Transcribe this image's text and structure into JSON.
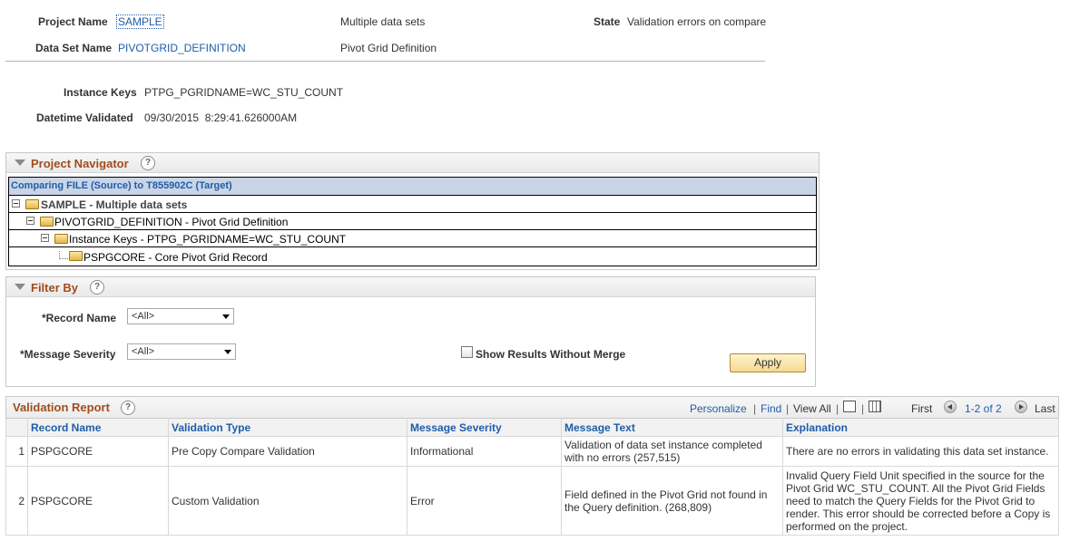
{
  "header": {
    "project_name_label": "Project Name",
    "project_name": "SAMPLE",
    "project_desc": "Multiple data sets",
    "state_label": "State",
    "state_value": "Validation errors on compare",
    "data_set_label": "Data Set Name",
    "data_set_name": "PIVOTGRID_DEFINITION",
    "data_set_desc": "Pivot Grid Definition"
  },
  "instance": {
    "keys_label": "Instance Keys",
    "keys_value": "PTPG_PGRIDNAME=WC_STU_COUNT",
    "datetime_label": "Datetime Validated",
    "datetime_value": "09/30/2015  8:29:41.626000AM"
  },
  "navigator": {
    "title": "Project Navigator",
    "help": "?",
    "caption": "Comparing FILE (Source) to T855902C (Target)",
    "nodes": [
      "SAMPLE - Multiple data sets",
      "PIVOTGRID_DEFINITION - Pivot Grid Definition",
      "Instance Keys - PTPG_PGRIDNAME=WC_STU_COUNT",
      "PSPGCORE - Core Pivot Grid Record"
    ]
  },
  "filter": {
    "title": "Filter By",
    "help": "?",
    "record_name_label": "*Record Name",
    "record_name_value": "<All>",
    "severity_label": "*Message Severity",
    "severity_value": "<All>",
    "show_results_label": "Show Results Without Merge",
    "apply_label": "Apply"
  },
  "report": {
    "title": "Validation Report",
    "help": "?",
    "personalize": "Personalize",
    "find": "Find",
    "view_all": "View All",
    "first": "First",
    "range": "1-2 of 2",
    "last": "Last",
    "columns": [
      "Record Name",
      "Validation Type",
      "Message Severity",
      "Message Text",
      "Explanation"
    ],
    "rows": [
      {
        "num": "1",
        "record": "PSPGCORE",
        "type": "Pre Copy Compare Validation",
        "severity": "Informational",
        "message": "Validation of data set instance completed with no errors (257,515)",
        "explanation": "There are no errors in validating this data set instance."
      },
      {
        "num": "2",
        "record": "PSPGCORE",
        "type": "Custom Validation",
        "severity": "Error",
        "message": "Field defined in the Pivot Grid not found in the Query definition. (268,809)",
        "explanation": "Invalid Query Field Unit specified in the source for the Pivot Grid WC_STU_COUNT. All the Pivot Grid Fields need to match the Query Fields for the Pivot Grid to render. This error should be corrected before a Copy is performed on the project."
      }
    ]
  }
}
